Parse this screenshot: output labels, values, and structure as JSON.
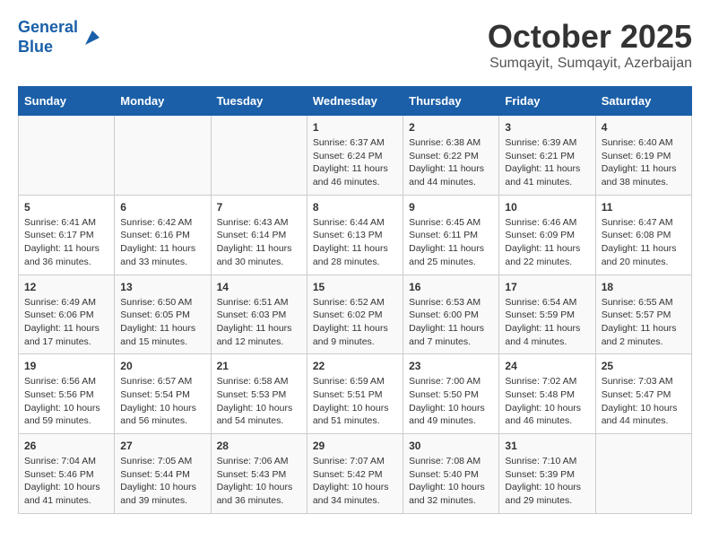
{
  "logo": {
    "line1": "General",
    "line2": "Blue"
  },
  "title": "October 2025",
  "subtitle": "Sumqayit, Sumqayit, Azerbaijan",
  "weekdays": [
    "Sunday",
    "Monday",
    "Tuesday",
    "Wednesday",
    "Thursday",
    "Friday",
    "Saturday"
  ],
  "weeks": [
    [
      {
        "day": "",
        "info": ""
      },
      {
        "day": "",
        "info": ""
      },
      {
        "day": "",
        "info": ""
      },
      {
        "day": "1",
        "info": "Sunrise: 6:37 AM\nSunset: 6:24 PM\nDaylight: 11 hours\nand 46 minutes."
      },
      {
        "day": "2",
        "info": "Sunrise: 6:38 AM\nSunset: 6:22 PM\nDaylight: 11 hours\nand 44 minutes."
      },
      {
        "day": "3",
        "info": "Sunrise: 6:39 AM\nSunset: 6:21 PM\nDaylight: 11 hours\nand 41 minutes."
      },
      {
        "day": "4",
        "info": "Sunrise: 6:40 AM\nSunset: 6:19 PM\nDaylight: 11 hours\nand 38 minutes."
      }
    ],
    [
      {
        "day": "5",
        "info": "Sunrise: 6:41 AM\nSunset: 6:17 PM\nDaylight: 11 hours\nand 36 minutes."
      },
      {
        "day": "6",
        "info": "Sunrise: 6:42 AM\nSunset: 6:16 PM\nDaylight: 11 hours\nand 33 minutes."
      },
      {
        "day": "7",
        "info": "Sunrise: 6:43 AM\nSunset: 6:14 PM\nDaylight: 11 hours\nand 30 minutes."
      },
      {
        "day": "8",
        "info": "Sunrise: 6:44 AM\nSunset: 6:13 PM\nDaylight: 11 hours\nand 28 minutes."
      },
      {
        "day": "9",
        "info": "Sunrise: 6:45 AM\nSunset: 6:11 PM\nDaylight: 11 hours\nand 25 minutes."
      },
      {
        "day": "10",
        "info": "Sunrise: 6:46 AM\nSunset: 6:09 PM\nDaylight: 11 hours\nand 22 minutes."
      },
      {
        "day": "11",
        "info": "Sunrise: 6:47 AM\nSunset: 6:08 PM\nDaylight: 11 hours\nand 20 minutes."
      }
    ],
    [
      {
        "day": "12",
        "info": "Sunrise: 6:49 AM\nSunset: 6:06 PM\nDaylight: 11 hours\nand 17 minutes."
      },
      {
        "day": "13",
        "info": "Sunrise: 6:50 AM\nSunset: 6:05 PM\nDaylight: 11 hours\nand 15 minutes."
      },
      {
        "day": "14",
        "info": "Sunrise: 6:51 AM\nSunset: 6:03 PM\nDaylight: 11 hours\nand 12 minutes."
      },
      {
        "day": "15",
        "info": "Sunrise: 6:52 AM\nSunset: 6:02 PM\nDaylight: 11 hours\nand 9 minutes."
      },
      {
        "day": "16",
        "info": "Sunrise: 6:53 AM\nSunset: 6:00 PM\nDaylight: 11 hours\nand 7 minutes."
      },
      {
        "day": "17",
        "info": "Sunrise: 6:54 AM\nSunset: 5:59 PM\nDaylight: 11 hours\nand 4 minutes."
      },
      {
        "day": "18",
        "info": "Sunrise: 6:55 AM\nSunset: 5:57 PM\nDaylight: 11 hours\nand 2 minutes."
      }
    ],
    [
      {
        "day": "19",
        "info": "Sunrise: 6:56 AM\nSunset: 5:56 PM\nDaylight: 10 hours\nand 59 minutes."
      },
      {
        "day": "20",
        "info": "Sunrise: 6:57 AM\nSunset: 5:54 PM\nDaylight: 10 hours\nand 56 minutes."
      },
      {
        "day": "21",
        "info": "Sunrise: 6:58 AM\nSunset: 5:53 PM\nDaylight: 10 hours\nand 54 minutes."
      },
      {
        "day": "22",
        "info": "Sunrise: 6:59 AM\nSunset: 5:51 PM\nDaylight: 10 hours\nand 51 minutes."
      },
      {
        "day": "23",
        "info": "Sunrise: 7:00 AM\nSunset: 5:50 PM\nDaylight: 10 hours\nand 49 minutes."
      },
      {
        "day": "24",
        "info": "Sunrise: 7:02 AM\nSunset: 5:48 PM\nDaylight: 10 hours\nand 46 minutes."
      },
      {
        "day": "25",
        "info": "Sunrise: 7:03 AM\nSunset: 5:47 PM\nDaylight: 10 hours\nand 44 minutes."
      }
    ],
    [
      {
        "day": "26",
        "info": "Sunrise: 7:04 AM\nSunset: 5:46 PM\nDaylight: 10 hours\nand 41 minutes."
      },
      {
        "day": "27",
        "info": "Sunrise: 7:05 AM\nSunset: 5:44 PM\nDaylight: 10 hours\nand 39 minutes."
      },
      {
        "day": "28",
        "info": "Sunrise: 7:06 AM\nSunset: 5:43 PM\nDaylight: 10 hours\nand 36 minutes."
      },
      {
        "day": "29",
        "info": "Sunrise: 7:07 AM\nSunset: 5:42 PM\nDaylight: 10 hours\nand 34 minutes."
      },
      {
        "day": "30",
        "info": "Sunrise: 7:08 AM\nSunset: 5:40 PM\nDaylight: 10 hours\nand 32 minutes."
      },
      {
        "day": "31",
        "info": "Sunrise: 7:10 AM\nSunset: 5:39 PM\nDaylight: 10 hours\nand 29 minutes."
      },
      {
        "day": "",
        "info": ""
      }
    ]
  ]
}
